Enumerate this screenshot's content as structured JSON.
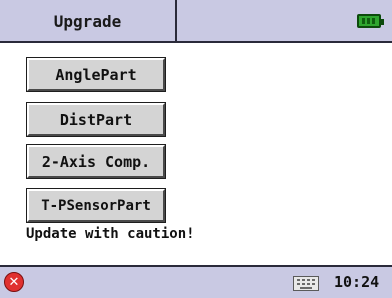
{
  "header": {
    "title": "Upgrade",
    "battery_icon": "battery-full-icon",
    "battery_color": "#2fa62f"
  },
  "buttons": {
    "angle_part": "AnglePart",
    "dist_part": "DistPart",
    "two_axis_comp": "2-Axis Comp.",
    "t_psensor_part": "T-PSensorPart"
  },
  "message": "Update with caution!",
  "statusbar": {
    "close_icon": "close-icon",
    "close_color": "#e0302f",
    "keyboard_icon": "keyboard-icon",
    "time": "10:24"
  },
  "colors": {
    "bar_background": "#c9c9e3",
    "button_face": "#d4d4d4"
  }
}
